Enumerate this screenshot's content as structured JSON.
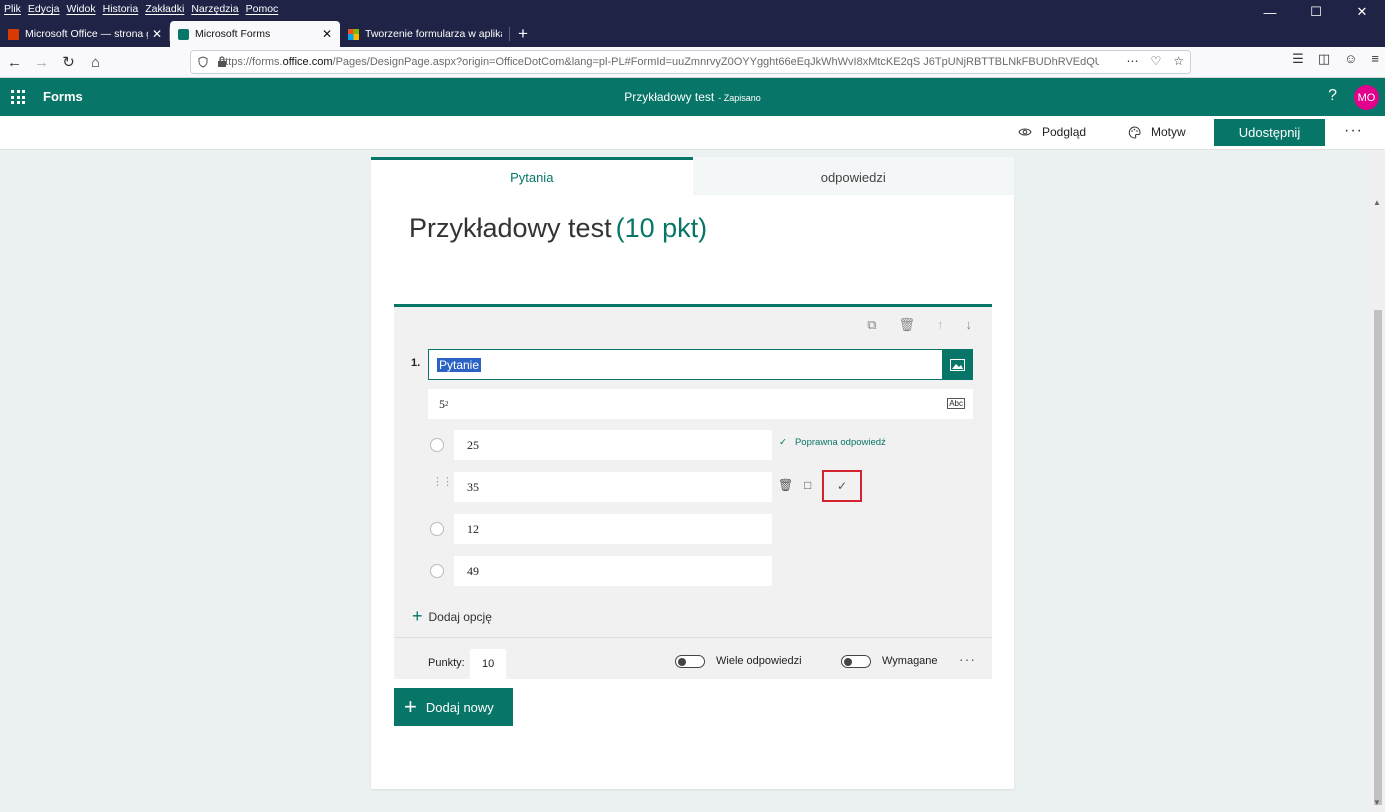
{
  "browser": {
    "menu": [
      "Plik",
      "Edycja",
      "Widok",
      "Historia",
      "Zakładki",
      "Narzędzia",
      "Pomoc"
    ],
    "tabs": [
      {
        "title": "Microsoft Office — strona głów",
        "icon": "office-icon"
      },
      {
        "title": "Microsoft Forms",
        "icon": "forms-icon"
      },
      {
        "title": "Tworzenie formularza w aplikac",
        "icon": "microsoft-icon"
      }
    ],
    "url_prefix": "https://forms.",
    "url_domain": "office.com",
    "url_rest": "/Pages/DesignPage.aspx?origin=OfficeDotCom&lang=pl-PL#FormId=uuZmnrvyZ0OYYgght66eEqJkWhWvI8xMtcKE2qS J6TpUNjRBTTBLNkFBUDhRVEdQUlkyMjVJTDJ"
  },
  "header": {
    "app_name": "Forms",
    "doc_title": "Przykładowy test",
    "saved": "- Zapisano",
    "help": "?",
    "avatar": "MO"
  },
  "toolbar": {
    "preview": "Podgląd",
    "theme": "Motyw",
    "share": "Udostępnij",
    "more": "···"
  },
  "tabs": {
    "questions": "Pytania",
    "responses": "odpowiedzi"
  },
  "form": {
    "title": "Przykładowy test",
    "points_label": "(10 pkt)"
  },
  "question": {
    "number": "1.",
    "text": "Pytanie",
    "subtitle_base": "5",
    "subtitle_exp": "2",
    "options": [
      "25",
      "35",
      "12",
      "49"
    ],
    "correct_label": "Poprawna odpowiedź",
    "add_option": "Dodaj opcję",
    "points_label": "Punkty:",
    "points_value": "10",
    "multiple": "Wiele odpowiedzi",
    "required": "Wymagane",
    "more": "···"
  },
  "add_new": "Dodaj nowy",
  "colors": {
    "accent": "#077568",
    "highlight_border": "#d1242f",
    "avatar": "#e3008c"
  }
}
